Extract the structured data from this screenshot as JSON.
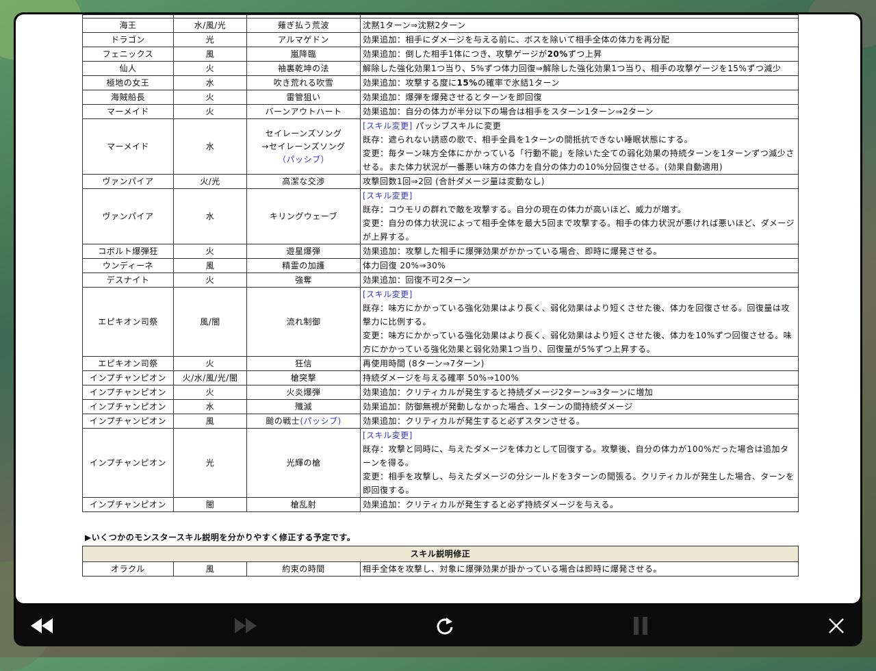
{
  "rows": [
    {
      "name": "海王",
      "attr": "水/風/光",
      "skill": "薙ぎ払う荒波",
      "desc": "沈黙1ターン⇒沈黙2ターン"
    },
    {
      "name": "ドラゴン",
      "attr": "光",
      "skill": "アルマゲドン",
      "desc": "効果追加：相手にダメージを与える前に、ボスを除いて相手全体の体力を再分配"
    },
    {
      "name": "フェニックス",
      "attr": "風",
      "skill": "嵐降臨",
      "desc_pre": "効果追加：倒した相手1体につき、攻撃ゲージが",
      "desc_bold": "20%",
      "desc_post": "ずつ上昇"
    },
    {
      "name": "仙人",
      "attr": "火",
      "skill": "袖裏乾坤の法",
      "desc": "解除した強化効果1つ当り、5%ずつ体力回復⇒解除した強化効果1つ当り、相手の攻撃ゲージを15%ずつ減少"
    },
    {
      "name": "極地の女王",
      "attr": "水",
      "skill": "吹き荒れる吹雪",
      "desc_pre": "効果追加：攻撃する度に",
      "desc_bold": "15%",
      "desc_post": "の確率で氷結1ターン"
    },
    {
      "name": "海賊船長",
      "attr": "火",
      "skill": "雷管狙い",
      "desc": "効果追加：爆弾を爆発させるとターンを即回復"
    },
    {
      "name": "マーメイド",
      "attr": "火",
      "skill": "バーンアウトハート",
      "desc": "効果追加：自分の体力が半分以下の場合は相手をスターン1ターン⇒2ターン"
    },
    {
      "name": "マーメイド",
      "attr": "水",
      "skill1": "セイレーンズソング",
      "skill2": "→セイレーンズソング",
      "skill3": "（パッシブ）",
      "tag": "[スキル変更]",
      "tag_post": " パッシブスキルに変更",
      "line2": "既存：遮られない誘惑の歌で、相手全員を1ターンの間抵抗できない睡眠状態にする。",
      "line3": "変更：毎ターン味方全体にかかっている「行動不能」を除いた全ての弱化効果の持続ターンを1ターンずつ減少させる。また体力状況が一番悪い味方の体力を自分の体力の10%分回復させる。(効果自動適用)"
    },
    {
      "name": "ヴァンパイア",
      "attr": "火/光",
      "skill": "高潔な交渉",
      "desc": "攻撃回数1回⇒2回 (合計ダメージ量は変動なし)"
    },
    {
      "name": "ヴァンパイア",
      "attr": "水",
      "skill": "キリングウェーブ",
      "tag": "[スキル変更]",
      "line2": "既存：コウモリの群れで敵を攻撃する。自分の現在の体力が高いほど、威力が増す。",
      "line3": "変更：自分の体力状況によって相手全体を最大5回まで攻撃する。相手の体力状況が悪ければ悪いほど、ダメージが上昇する。"
    },
    {
      "name": "コボルト爆弾狂",
      "attr": "火",
      "skill": "遊星爆弾",
      "desc": "効果追加：攻撃した相手に爆弾効果がかかっている場合、即時に爆発させる。"
    },
    {
      "name": "ウンディーネ",
      "attr": "風",
      "skill": "精霊の加護",
      "desc": "体力回復 20%⇒30%"
    },
    {
      "name": "デスナイト",
      "attr": "火",
      "skill": "強奪",
      "desc": "効果追加：回復不可2ターン"
    },
    {
      "name": "エピキオン司祭",
      "attr": "風/闇",
      "skill": "流れ制御",
      "tag": "[スキル変更]",
      "line2": "既存：味方にかかっている強化効果はより長く、弱化効果はより短くさせた後、体力を回復させる。回復量は攻撃力に比例する。",
      "line3": "変更：味方にかかっている強化効果はより長く、弱化効果はより短くさせた後、体力を10%ずつ回復させる。味方にかかっている強化効果と弱化効果1つ当り、回復量が5%ずつ上昇する。"
    },
    {
      "name": "エピキオン司祭",
      "attr": "火",
      "skill": "狂信",
      "desc": "再使用時間 (8ターン⇒7ターン)"
    },
    {
      "name": "インプチャンピオン",
      "attr": "火/水/風/光/闇",
      "skill": "槍突撃",
      "desc": "持続ダメージを与える確率 50%⇒100%"
    },
    {
      "name": "インプチャンピオン",
      "attr": "火",
      "skill": "火炎爆弾",
      "desc": "効果追加：クリティカルが発生すると持続ダメージ2ターン⇒3ターンに増加"
    },
    {
      "name": "インプチャンピオン",
      "attr": "水",
      "skill": "殲滅",
      "desc": "効果追加：防御無視が発動しなかった場合、1ターンの間持続ダメージ"
    },
    {
      "name": "インプチャンピオン",
      "attr": "風",
      "skill": "颱の戦士",
      "skill_pas": "(パッシブ)",
      "desc": "効果追加：クリティカルが発生すると必ずスタンさせる。"
    },
    {
      "name": "インプチャンピオン",
      "attr": "光",
      "skill": "光輝の槍",
      "tag": "[スキル変更]",
      "line2": "既存：攻撃と同時に、与えたダメージを体力として回復する。攻撃後、自分の体力が100%だった場合は追加ターンを得る。",
      "line3": "変更：相手を攻撃し、与えたダメージの分シールドを3ターンの間張る。クリティカルが発生した場合、ターンを即回復する。"
    },
    {
      "name": "インプチャンピオン",
      "attr": "闇",
      "skill": "槍乱射",
      "desc": "効果追加：クリティカルが発生すると必ず持続ダメージを与える。"
    }
  ],
  "note": "▶いくつかのモンスタースキル説明を分かりやすく修正する予定です。",
  "fix_header": "スキル説明修正",
  "fix_row": {
    "name": "オラクル",
    "attr": "風",
    "skill": "約束の時間",
    "desc": "相手全体を攻撃し、対象に爆弾効果が掛かっている場合は即時に爆発させる。"
  },
  "controls": {
    "prev": "rewind-icon",
    "next": "fast-forward-icon",
    "reload": "refresh-icon",
    "pause": "pause-icon",
    "close": "close-icon"
  }
}
